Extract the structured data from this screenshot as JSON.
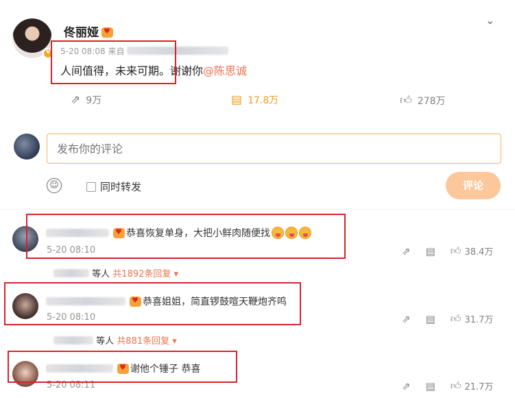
{
  "post": {
    "author": "佟丽娅",
    "date": "5-20 08:08",
    "source_prefix": "来自",
    "text_main": "人间值得，未来可期。谢谢你",
    "mention": "@陈思诚",
    "reposts": "9万",
    "comments": "17.8万",
    "likes": "278万"
  },
  "composer": {
    "placeholder": "发布你的评论",
    "repost_label": "同时转发",
    "submit_label": "评论"
  },
  "comments": [
    {
      "text": "恭喜恢复单身，大把小鲜肉随便找",
      "time": "5-20 08:10",
      "likes": "38.4万",
      "reply_suffix": "等人",
      "reply_count": "共1892条回复"
    },
    {
      "text": "恭喜姐姐，简直锣鼓喧天鞭炮齐鸣",
      "time": "5-20 08:10",
      "likes": "31.7万",
      "reply_suffix": "等人",
      "reply_count": "共881条回复"
    },
    {
      "text": "谢他个锤子 恭喜",
      "time": "5-20 08:11",
      "likes": "21.7万"
    }
  ],
  "colors": {
    "accent": "#eb7350",
    "active": "#f39a18",
    "highlight_box": "#d9202a"
  }
}
